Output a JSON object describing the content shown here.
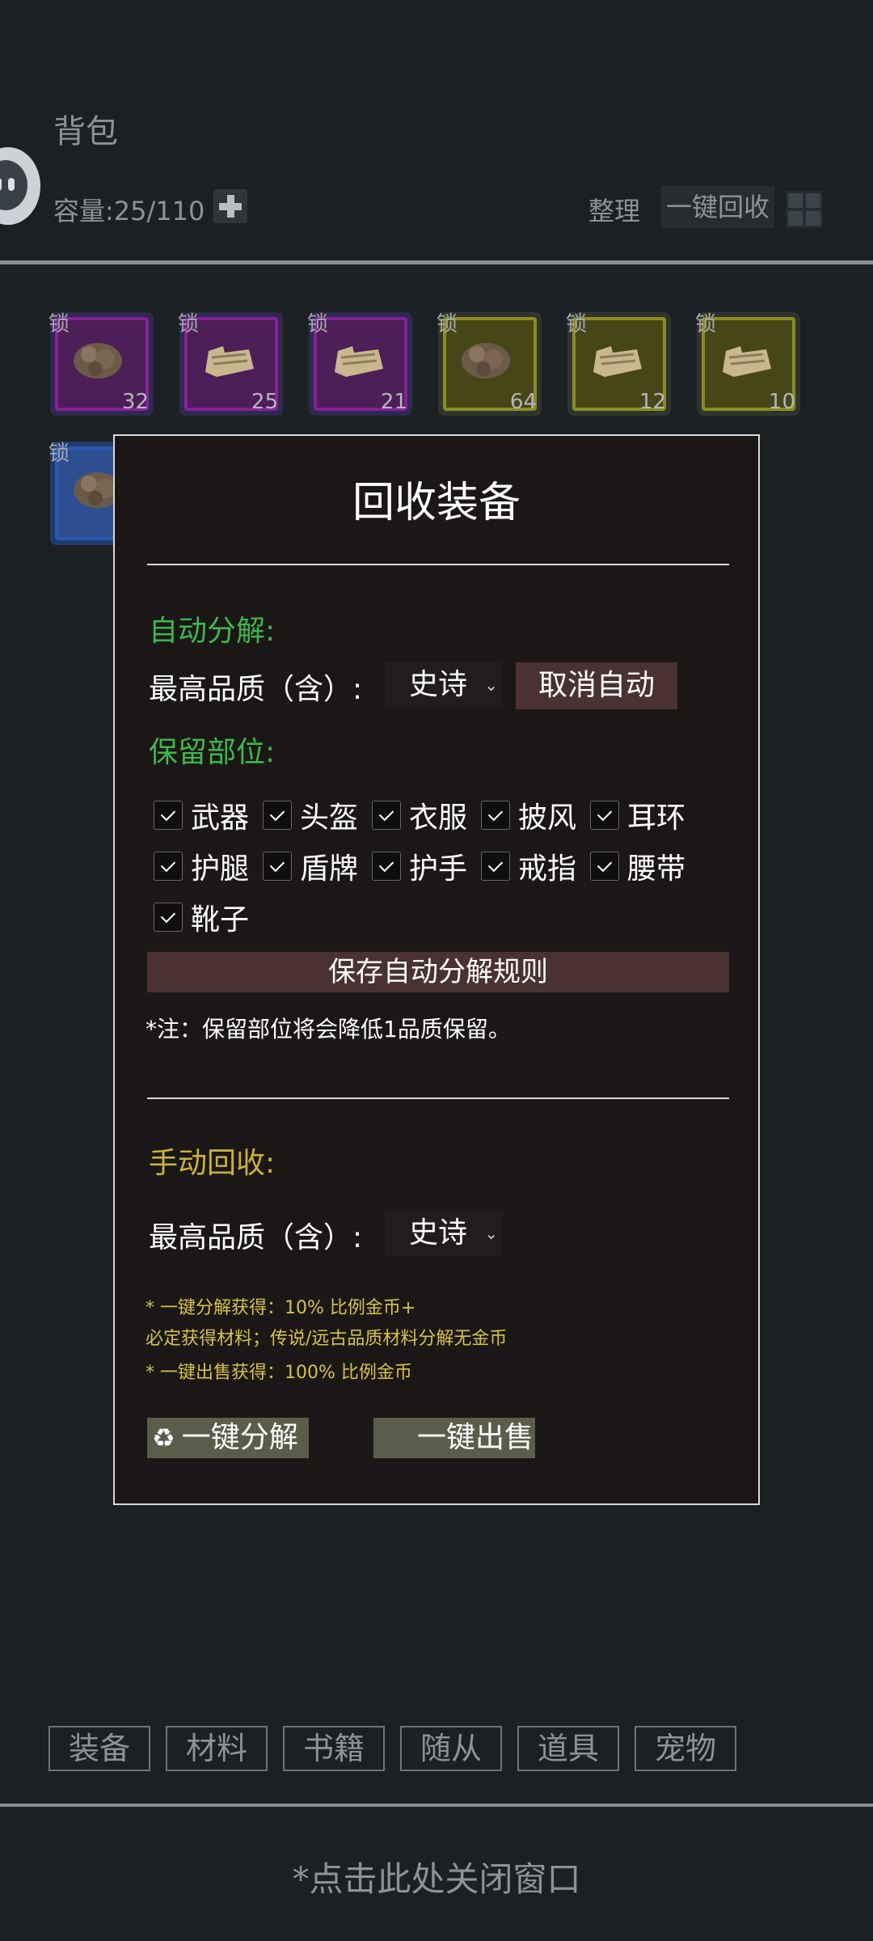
{
  "header": {
    "title": "背包",
    "capacity": "容量:25/110",
    "sort_label": "整理",
    "recycle_label": "一键回收"
  },
  "inventory": {
    "items": [
      {
        "lock": "锁",
        "count": "32",
        "rarity": "purple",
        "icon": "ore-icon"
      },
      {
        "lock": "锁",
        "count": "25",
        "rarity": "purple",
        "icon": "paper-icon"
      },
      {
        "lock": "锁",
        "count": "21",
        "rarity": "purple",
        "icon": "paper-icon"
      },
      {
        "lock": "锁",
        "count": "64",
        "rarity": "yellow",
        "icon": "ore-icon"
      },
      {
        "lock": "锁",
        "count": "12",
        "rarity": "yellow",
        "icon": "paper-icon"
      },
      {
        "lock": "锁",
        "count": "10",
        "rarity": "yellow",
        "icon": "paper-icon"
      },
      {
        "lock": "锁",
        "count": "",
        "rarity": "blue",
        "icon": "ore-icon"
      }
    ]
  },
  "modal": {
    "title": "回收装备",
    "auto_heading": "自动分解:",
    "quality_label": "最高品质（含）:",
    "auto_quality": "史诗",
    "cancel_auto": "取消自动",
    "keep_heading": "保留部位:",
    "slots": [
      {
        "label": "武器",
        "checked": true
      },
      {
        "label": "头盔",
        "checked": true
      },
      {
        "label": "衣服",
        "checked": true
      },
      {
        "label": "披风",
        "checked": true
      },
      {
        "label": "耳环",
        "checked": true
      },
      {
        "label": "护腿",
        "checked": true
      },
      {
        "label": "盾牌",
        "checked": true
      },
      {
        "label": "护手",
        "checked": true
      },
      {
        "label": "戒指",
        "checked": true
      },
      {
        "label": "腰带",
        "checked": true
      },
      {
        "label": "靴子",
        "checked": true
      }
    ],
    "save_rules": "保存自动分解规则",
    "note": "*注：保留部位将会降低1品质保留。",
    "manual_heading": "手动回收:",
    "manual_quality": "史诗",
    "info_1": "* 一键分解获得：10% 比例金币+",
    "info_2": "必定获得材料；传说/远古品质材料分解无金币",
    "info_3": "* 一键出售获得：100% 比例金币",
    "decompose_label": "一键分解",
    "sell_label": "一键出售"
  },
  "tabs": [
    "装备",
    "材料",
    "书籍",
    "随从",
    "道具",
    "宠物"
  ],
  "close_hint": "*点击此处关闭窗口",
  "colors": {
    "accent_green": "#3cb84a",
    "accent_yellow": "#c8b23a",
    "modal_bg": "#1c1717"
  }
}
